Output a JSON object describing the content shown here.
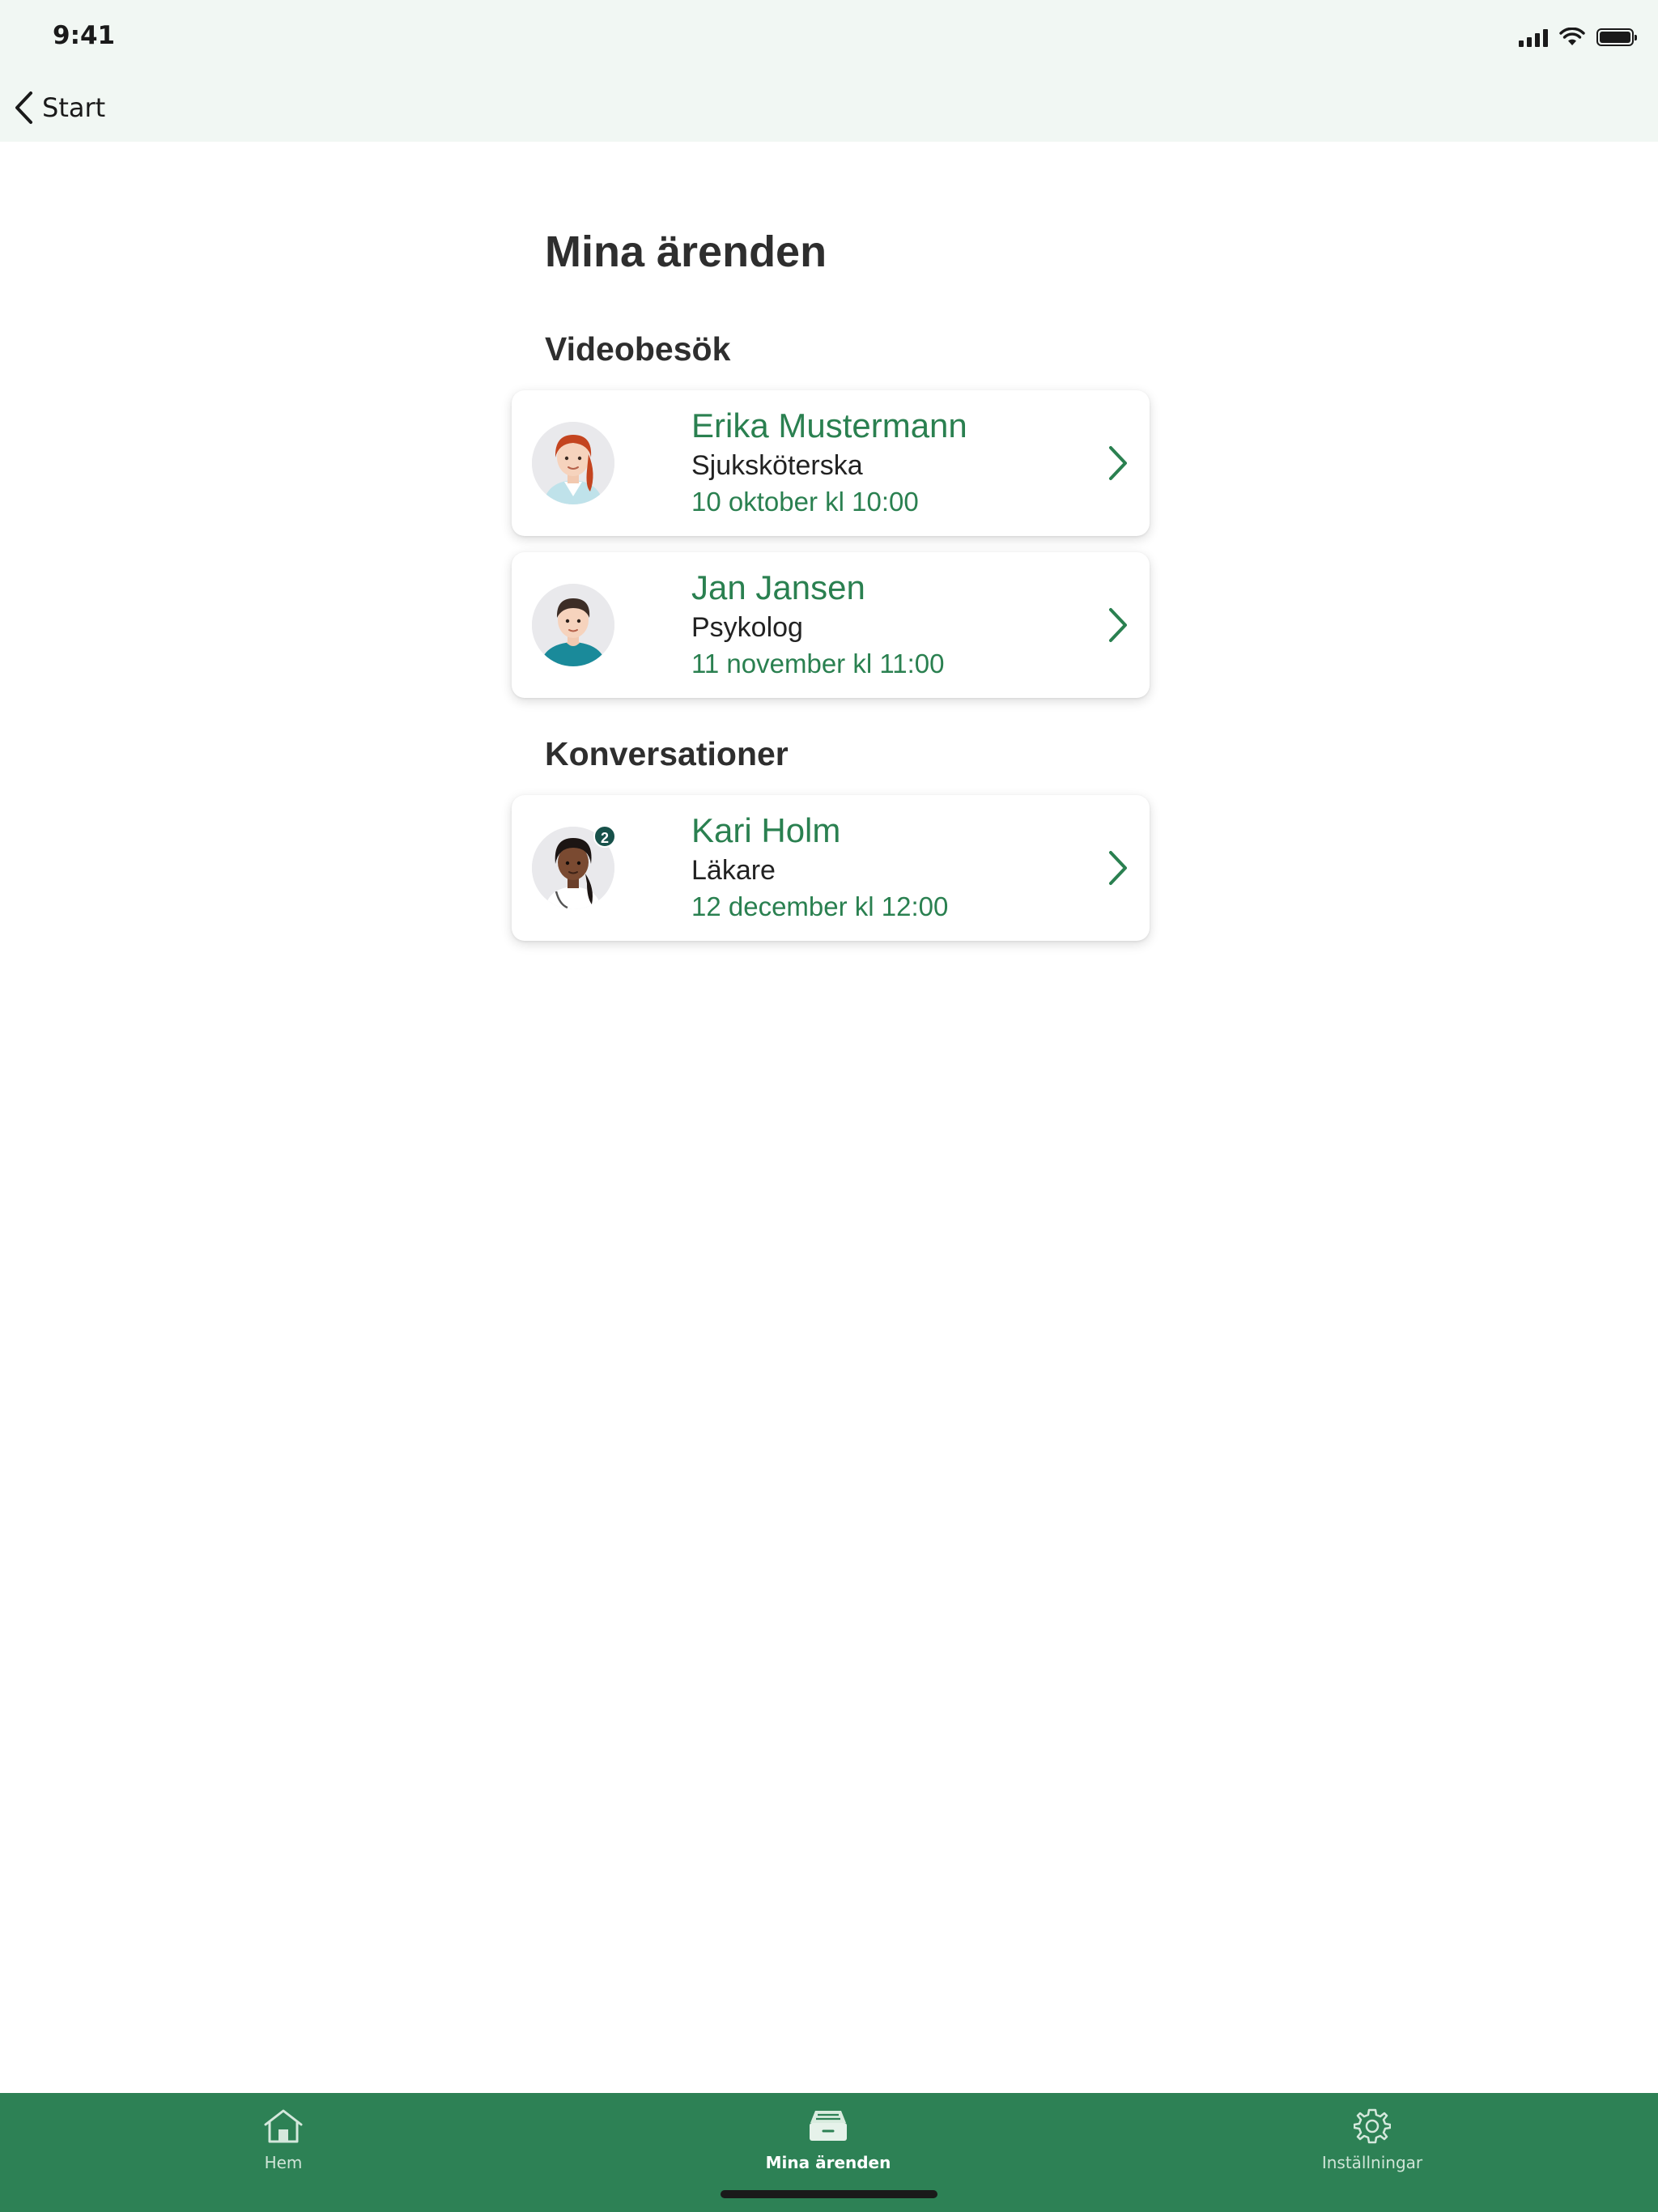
{
  "status_bar": {
    "time": "9:41"
  },
  "nav": {
    "back_label": "Start"
  },
  "page_title": "Mina ärenden",
  "sections": [
    {
      "title": "Videobesök",
      "cards": [
        {
          "name": "Erika Mustermann",
          "role": "Sjuksköterska",
          "date": "10 oktober kl 10:00"
        },
        {
          "name": "Jan Jansen",
          "role": "Psykolog",
          "date": "11 november kl 11:00"
        }
      ]
    },
    {
      "title": "Konversationer",
      "cards": [
        {
          "name": "Kari Holm",
          "role": "Läkare",
          "date": "12 december kl 12:00",
          "badge": "2"
        }
      ]
    }
  ],
  "tabbar": {
    "tabs": [
      {
        "label": "Hem",
        "icon": "home-icon"
      },
      {
        "label": "Mina ärenden",
        "icon": "inbox-tray-icon",
        "active": true
      },
      {
        "label": "Inställningar",
        "icon": "gear-icon"
      }
    ]
  },
  "colors": {
    "accent_green": "#2a8050",
    "tabbar_green": "#2d8155",
    "topbar_bg": "#f1f7f3",
    "badge_bg": "#17514a"
  }
}
